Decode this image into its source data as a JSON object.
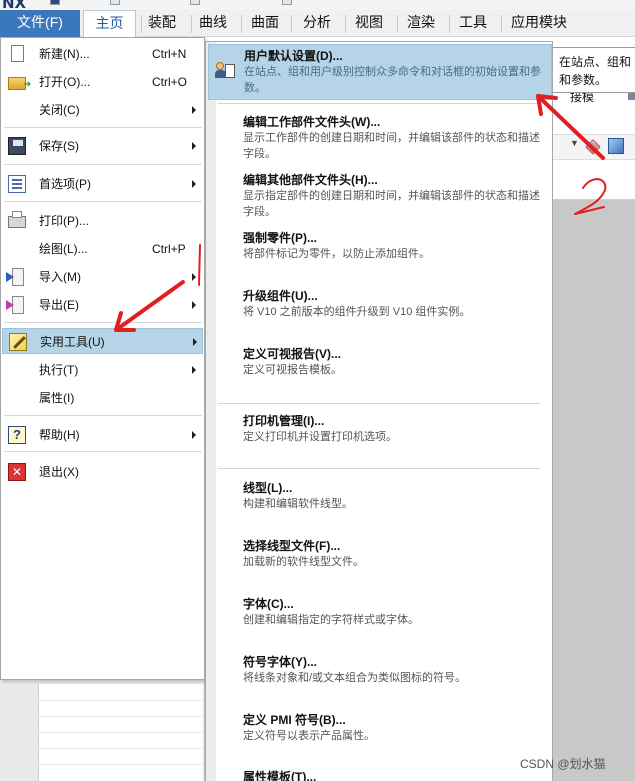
{
  "app": {
    "logo": "NX",
    "watermark": "CSDN @划水猫"
  },
  "menubar": {
    "tabs": [
      {
        "label": "文件(F)"
      },
      {
        "label": "主页"
      },
      {
        "label": "装配"
      },
      {
        "label": "曲线"
      },
      {
        "label": "曲面"
      },
      {
        "label": "分析"
      },
      {
        "label": "视图"
      },
      {
        "label": "渲染"
      },
      {
        "label": "工具"
      },
      {
        "label": "应用模块"
      }
    ]
  },
  "background": {
    "tooltip_line1": "在站点、组和",
    "tooltip_line2": "和参数。",
    "join_label": "接模"
  },
  "file_menu": {
    "items": [
      {
        "label": "新建(N)...",
        "shortcut": "Ctrl+N",
        "icon": "new-file-icon"
      },
      {
        "label": "打开(O)...",
        "shortcut": "Ctrl+O",
        "icon": "open-folder-icon"
      },
      {
        "label": "关闭(C)",
        "shortcut": "",
        "icon": ""
      },
      {
        "label": "保存(S)",
        "shortcut": "",
        "icon": "save-icon"
      },
      {
        "label": "首选项(P)",
        "shortcut": "",
        "icon": "preferences-icon"
      },
      {
        "label": "打印(P)...",
        "shortcut": "",
        "icon": "print-icon"
      },
      {
        "label": "绘图(L)...",
        "shortcut": "Ctrl+P",
        "icon": ""
      },
      {
        "label": "导入(M)",
        "shortcut": "",
        "icon": "import-icon"
      },
      {
        "label": "导出(E)",
        "shortcut": "",
        "icon": "export-icon"
      },
      {
        "label": "实用工具(U)",
        "shortcut": "",
        "icon": "utilities-icon"
      },
      {
        "label": "执行(T)",
        "shortcut": "",
        "icon": ""
      },
      {
        "label": "属性(I)",
        "shortcut": "",
        "icon": ""
      },
      {
        "label": "帮助(H)",
        "shortcut": "",
        "icon": "help-icon"
      },
      {
        "label": "退出(X)",
        "shortcut": "",
        "icon": "exit-icon"
      }
    ]
  },
  "utilities_menu": {
    "items": [
      {
        "title": "用户默认设置(D)...",
        "desc": "在站点、组和用户级别控制众多命令和对话框的初始设置和参数。"
      },
      {
        "title": "编辑工作部件文件头(W)...",
        "desc": "显示工作部件的创建日期和时间，并编辑该部件的状态和描述字段。"
      },
      {
        "title": "编辑其他部件文件头(H)...",
        "desc": "显示指定部件的创建日期和时间，并编辑该部件的状态和描述字段。"
      },
      {
        "title": "强制零件(P)...",
        "desc": "将部件标记为零件，以防止添加组件。"
      },
      {
        "title": "升级组件(U)...",
        "desc": "将 V10 之前版本的组件升级到 V10 组件实例。"
      },
      {
        "title": "定义可视报告(V)...",
        "desc": "定义可视报告模板。"
      },
      {
        "title": "打印机管理(I)...",
        "desc": "定义打印机并设置打印机选项。"
      },
      {
        "title": "线型(L)...",
        "desc": "构建和编辑软件线型。"
      },
      {
        "title": "选择线型文件(F)...",
        "desc": "加载新的软件线型文件。"
      },
      {
        "title": "字体(C)...",
        "desc": "创建和编辑指定的字符样式或字体。"
      },
      {
        "title": "符号字体(Y)...",
        "desc": "将线条对象和/或文本组合为类似图标的符号。"
      },
      {
        "title": "定义 PMI 符号(B)...",
        "desc": "定义符号以表示产品属性。"
      },
      {
        "title": "属性模板(T)...",
        "desc": ""
      }
    ]
  },
  "colors": {
    "file_tab": "#3b77bd",
    "highlight": "#b5d4e8",
    "annotation": "#e02020"
  }
}
